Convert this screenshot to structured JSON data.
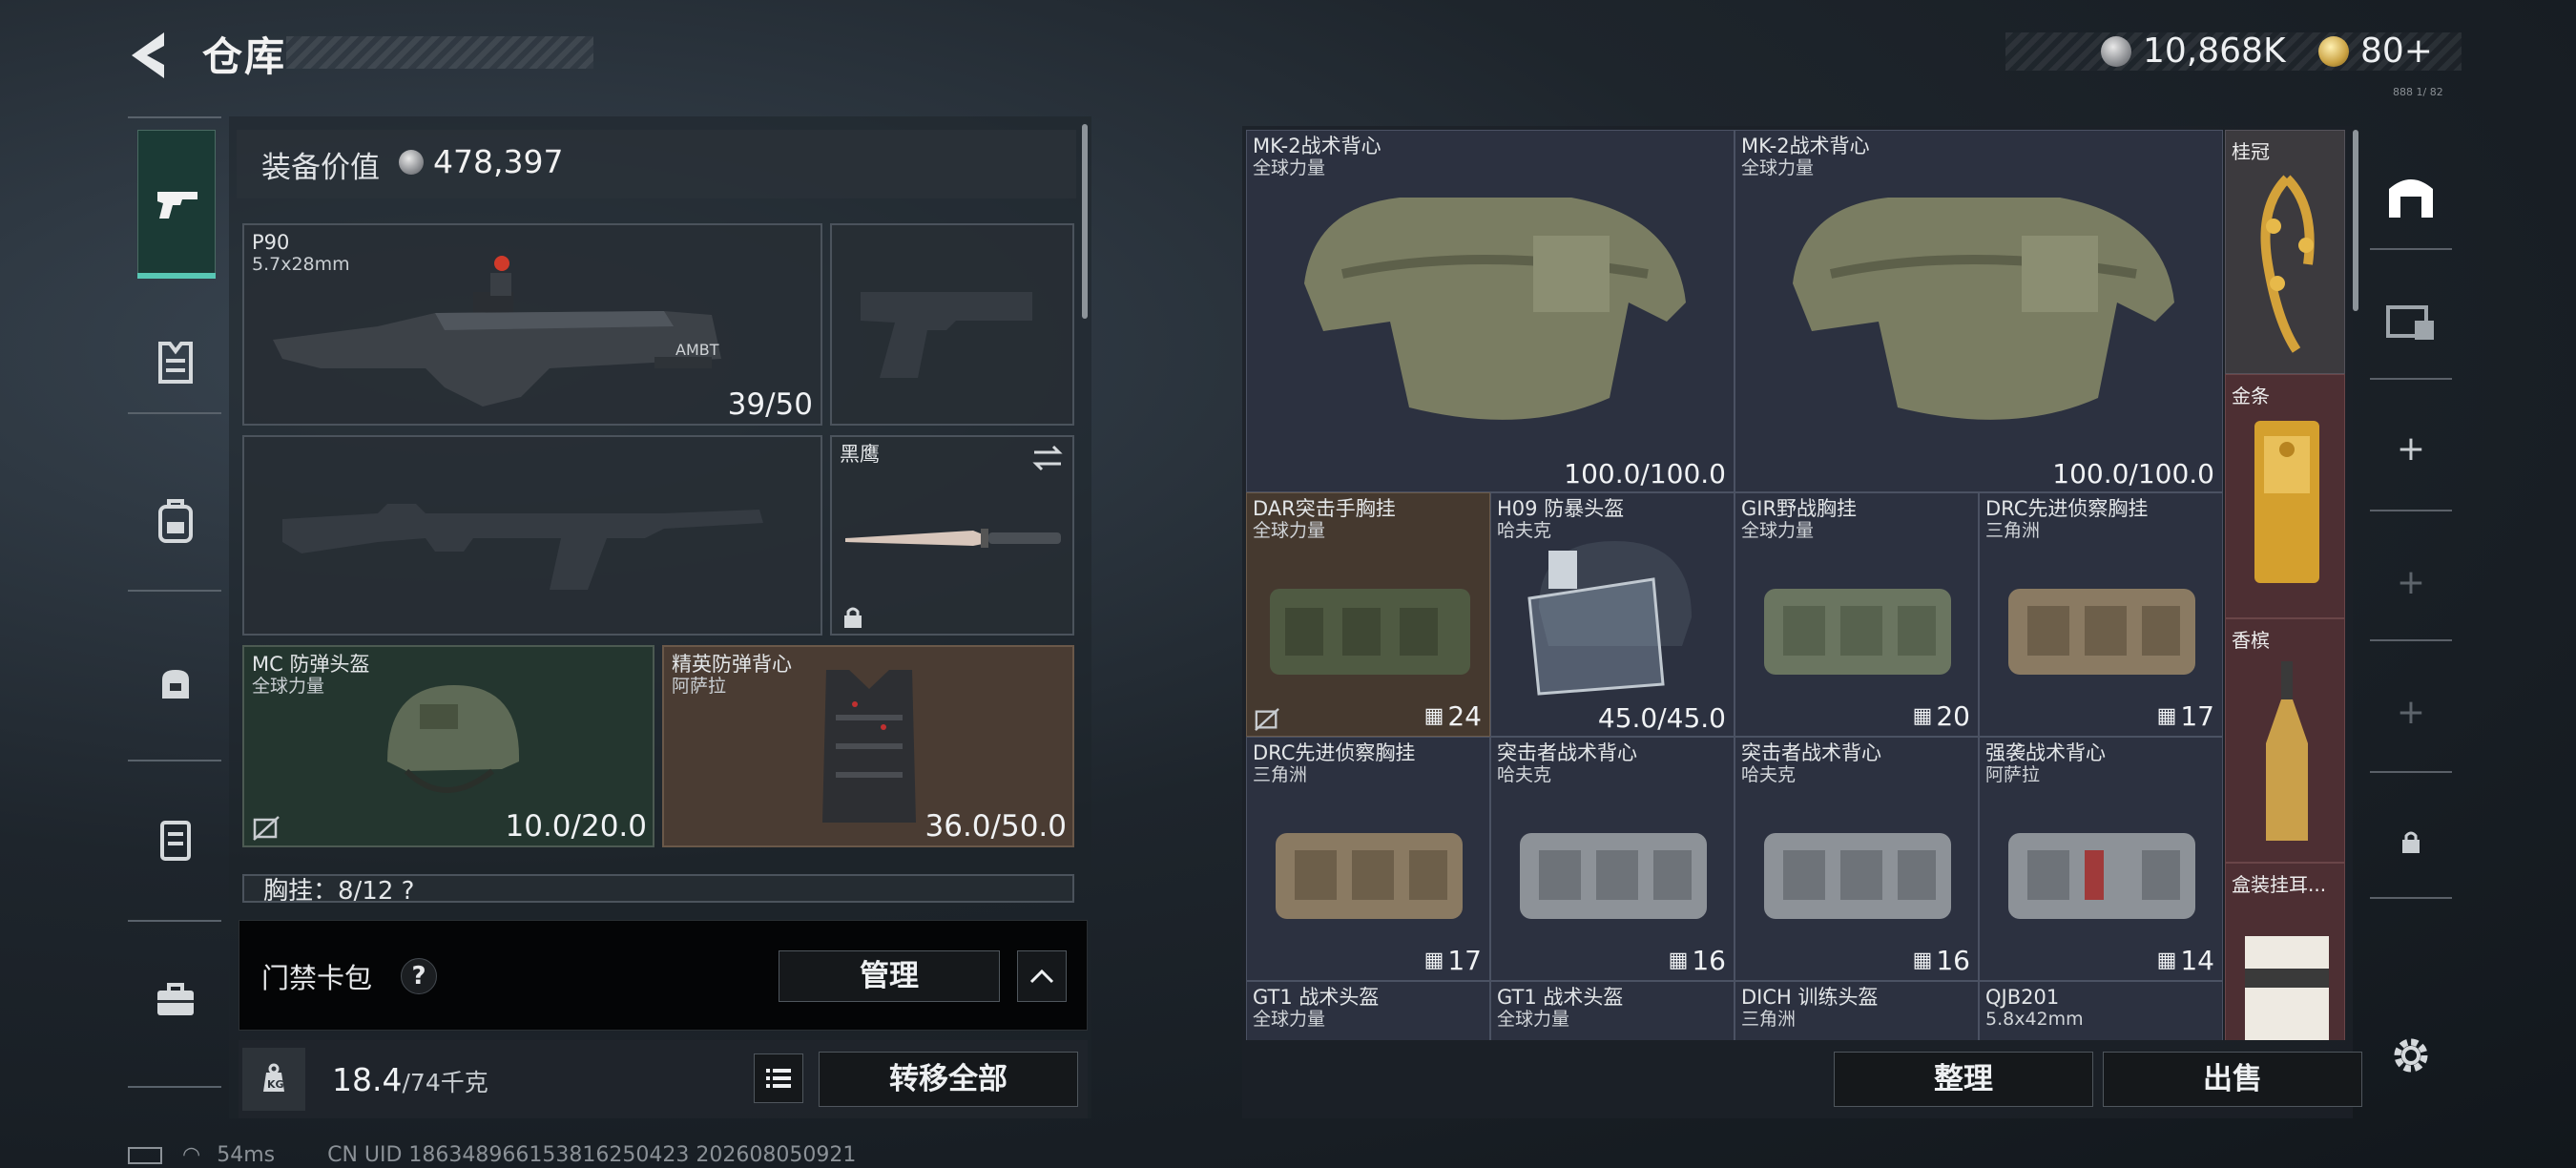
{
  "header": {
    "title": "仓库",
    "currency_silver": "10,868K",
    "currency_gold": "80+",
    "version_tag": "888 1/ 82"
  },
  "left_tabs": [
    {
      "name": "weapon",
      "icon": "pistol-icon",
      "active": true
    },
    {
      "name": "armor",
      "icon": "vest-icon"
    },
    {
      "name": "backpack",
      "icon": "backpack-icon"
    },
    {
      "name": "pouch",
      "icon": "pouch-icon"
    },
    {
      "name": "container",
      "icon": "case-icon"
    },
    {
      "name": "briefcase",
      "icon": "briefcase-icon"
    }
  ],
  "loadout": {
    "equip_value_label": "装备价值",
    "equip_value": "478,397",
    "primary": {
      "name": "P90",
      "caliber": "5.7x28mm",
      "ammo": "39/50"
    },
    "knife": {
      "name": "黑鹰"
    },
    "helmet": {
      "name": "MC 防弹头盔",
      "faction": "全球力量",
      "durability": "10.0/20.0"
    },
    "vest": {
      "name": "精英防弹背心",
      "faction": "阿萨拉",
      "durability": "36.0/50.0"
    },
    "rig_label": "胸挂：8/12  ?",
    "keycard_label": "门禁卡包",
    "keycard_help": "?",
    "manage_label": "管理",
    "weight_value": "18.4",
    "weight_max": "/74千克",
    "transfer_all_label": "转移全部"
  },
  "storage": {
    "items": [
      {
        "name": "MK-2战术背心",
        "faction": "全球力量",
        "value": "100.0/100.0"
      },
      {
        "name": "MK-2战术背心",
        "faction": "全球力量",
        "value": "100.0/100.0"
      },
      {
        "name": "DAR突击手胸挂",
        "faction": "全球力量",
        "value": "24"
      },
      {
        "name": "H09 防暴头盔",
        "faction": "哈夫克",
        "value": "45.0/45.0"
      },
      {
        "name": "GIR野战胸挂",
        "faction": "全球力量",
        "value": "20"
      },
      {
        "name": "DRC先进侦察胸挂",
        "faction": "三角洲",
        "value": "17"
      },
      {
        "name": "DRC先进侦察胸挂",
        "faction": "三角洲",
        "value": "17"
      },
      {
        "name": "突击者战术背心",
        "faction": "哈夫克",
        "value": "16"
      },
      {
        "name": "突击者战术背心",
        "faction": "哈夫克",
        "value": "16"
      },
      {
        "name": "强袭战术背心",
        "faction": "阿萨拉",
        "value": "14"
      },
      {
        "name": "GT1 战术头盔",
        "faction": "全球力量",
        "value": ""
      },
      {
        "name": "GT1 战术头盔",
        "faction": "全球力量",
        "value": ""
      },
      {
        "name": "DICH 训练头盔",
        "faction": "三角洲",
        "value": ""
      },
      {
        "name": "QJB201",
        "faction": "5.8x42mm",
        "value": ""
      }
    ],
    "valuables": [
      {
        "name": "桂冠"
      },
      {
        "name": "金条"
      },
      {
        "name": "香槟"
      },
      {
        "name": "盒装挂耳..."
      }
    ],
    "sort_label": "整理",
    "sell_label": "出售"
  },
  "status": {
    "ping": "54ms",
    "uid": "CN UID 18634896615381625042​3 202608050921"
  },
  "colors": {
    "accent_teal": "#58c7b4",
    "legendary_red": "#4d2f33",
    "epic_brown": "#45392f",
    "item_blue": "#2c3140"
  }
}
